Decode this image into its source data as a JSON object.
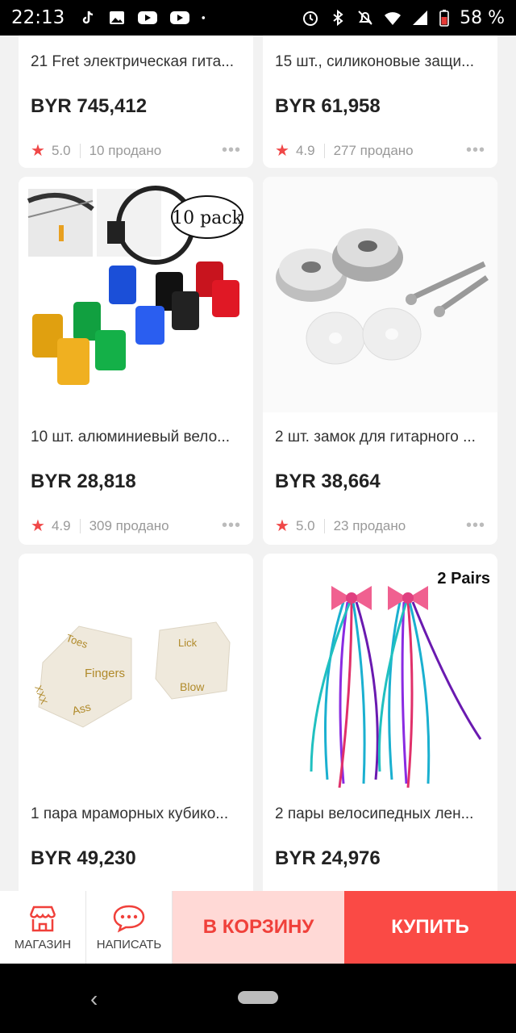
{
  "status_bar": {
    "time": "22:13",
    "battery": "58 %",
    "left_icons": [
      "tiktok-icon",
      "gallery-icon",
      "youtube-icon",
      "youtube-icon",
      "dot-icon"
    ],
    "right_icons": [
      "alarm-icon",
      "bluetooth-icon",
      "mute-icon",
      "wifi-icon",
      "signal-icon",
      "battery-icon"
    ]
  },
  "products": [
    {
      "title": "21 Fret электрическая гита...",
      "price": "BYR 745,412",
      "rating": "5.0",
      "sold": "10 продано"
    },
    {
      "title": "15 шт., силиконовые защи...",
      "price": "BYR 61,958",
      "rating": "4.9",
      "sold": "277 продано"
    },
    {
      "title": "10 шт. алюминиевый вело...",
      "price": "BYR 28,818",
      "rating": "4.9",
      "sold": "309 продано",
      "badge": "10 pack"
    },
    {
      "title": "2 шт. замок для гитарного ...",
      "price": "BYR 38,664",
      "rating": "5.0",
      "sold": "23 продано"
    },
    {
      "title": "1 пара мраморных кубико...",
      "price": "BYR 49,230",
      "dice_words": [
        "Toes",
        "Fingers",
        "XXX",
        "Ass",
        "Lick",
        "Blow"
      ]
    },
    {
      "title": "2 пары велосипедных лен...",
      "price": "BYR 24,976",
      "badge": "2 Pairs"
    }
  ],
  "action_bar": {
    "store_label": "МАГАЗИН",
    "message_label": "НАПИСАТЬ",
    "cart_label": "В КОРЗИНУ",
    "buy_label": "КУПИТЬ"
  },
  "colors": {
    "accent": "#fa4a45",
    "cart_bg": "#ffd9d6",
    "star": "#f04848"
  }
}
